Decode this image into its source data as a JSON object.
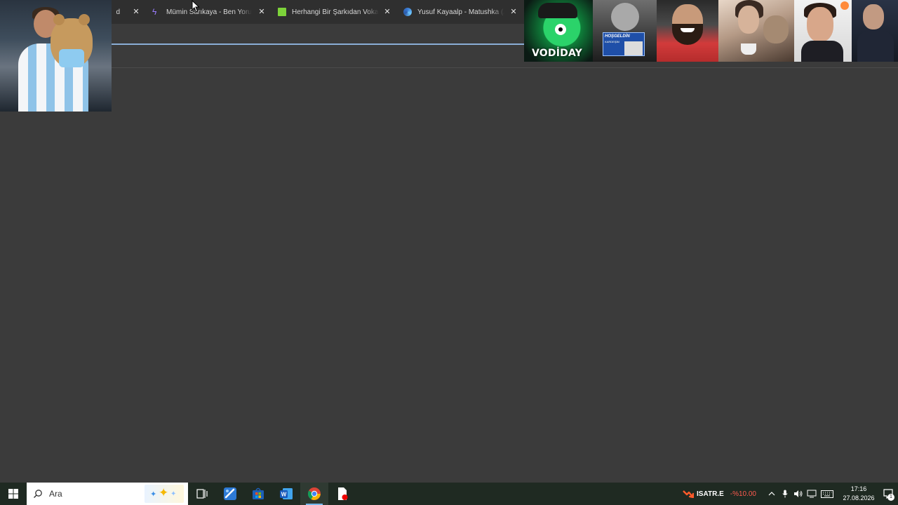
{
  "browser": {
    "tabs": [
      {
        "title": "d",
        "favicon": "none"
      },
      {
        "title": "Mümin Sarıkaya - Ben Yoruldum",
        "favicon": "bolt-icon"
      },
      {
        "title": "Herhangi Bir Şarkıdan Vokal Ayırma",
        "favicon": "green-square-icon"
      },
      {
        "title": "Yusuf Kayaalp - Matushka (A",
        "favicon": "edge-icon"
      }
    ]
  },
  "overlay": {
    "thumbnails": [
      {
        "label": "VODİDAY"
      },
      {
        "sign_title": "HOŞGELDİN",
        "sign_sub": "KARDEŞİM"
      },
      {},
      {},
      {},
      {}
    ]
  },
  "taskbar": {
    "search_placeholder": "Ara",
    "apps": [
      "task-view",
      "photos",
      "store",
      "word",
      "chrome",
      "pdf"
    ],
    "stock": {
      "name": "ISATR.E",
      "change": "-%10.00"
    },
    "clock": {
      "time": "17:16",
      "date": "27.08.2026"
    },
    "notifications_count": "1"
  },
  "colors": {
    "page_bg": "#3b3b3b",
    "tabstrip_bg": "#2f2f2f",
    "taskbar_bg": "#1f2a22",
    "accent": "#76b9ed",
    "stock_down": "#ff5a4e"
  }
}
